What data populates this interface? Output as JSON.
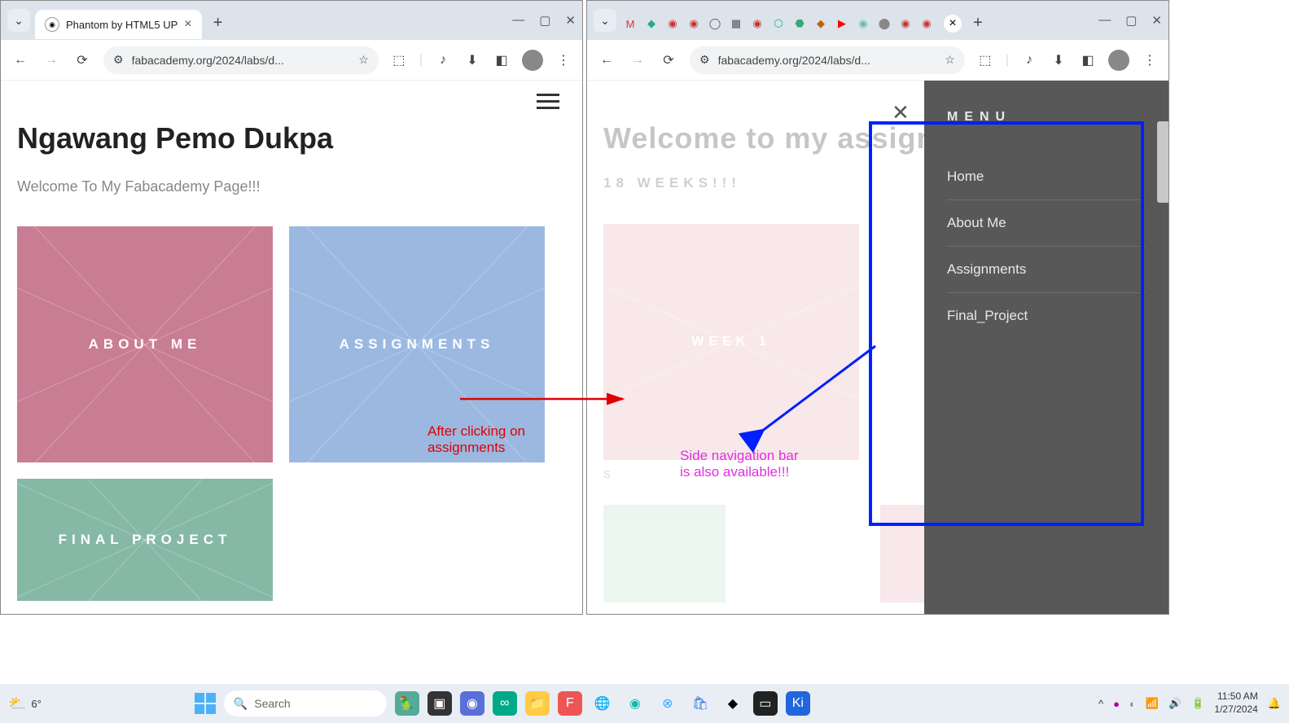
{
  "left_window": {
    "tab_title": "Phantom by HTML5 UP",
    "url": "fabacademy.org/2024/labs/d...",
    "page_title": "Ngawang Pemo Dukpa",
    "subtitle": "Welcome To My Fabacademy Page!!!",
    "tiles": {
      "about": "ABOUT ME",
      "assignments": "ASSIGNMENTS",
      "final": "FINAL PROJECT"
    }
  },
  "right_window": {
    "url": "fabacademy.org/2024/labs/d...",
    "page_title": "Welcome to my assignmen",
    "subtitle": "18 WEEKS!!!",
    "tile_week1": "WEEK 1",
    "stray_s": "S",
    "menu": {
      "title": "MENU",
      "items": [
        "Home",
        "About Me",
        "Assignments",
        "Final_Project"
      ]
    }
  },
  "annotations": {
    "red_line1": "After clicking on",
    "red_line2": "assignments",
    "pink_line1": "Side navigation bar",
    "pink_line2": "is also available!!!"
  },
  "taskbar": {
    "temp": "6°",
    "search_placeholder": "Search",
    "time": "11:50 AM",
    "date": "1/27/2024"
  }
}
